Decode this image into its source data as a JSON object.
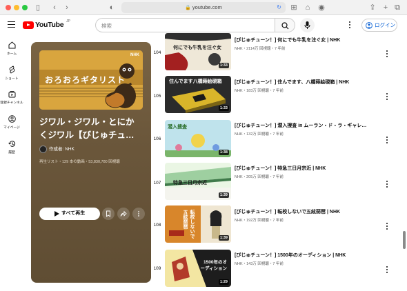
{
  "browser": {
    "url": "youtube.com"
  },
  "header": {
    "logo_text": "YouTube",
    "logo_region": "JP",
    "search_placeholder": "検索",
    "login_label": "ログイン"
  },
  "nav": [
    {
      "label": "ホーム",
      "icon": "home-icon"
    },
    {
      "label": "ショート",
      "icon": "shorts-icon"
    },
    {
      "label": "登録チャンネル",
      "icon": "subscriptions-icon"
    },
    {
      "label": "マイページ",
      "icon": "account-icon"
    },
    {
      "label": "履歴",
      "icon": "history-icon"
    }
  ],
  "playlist": {
    "thumb_text": "おろおろギタリスト",
    "thumb_brand": "NHK",
    "title_line1": "ジワル・ジワル・とにか",
    "title_line2": "くジワル【びじゅチュ…",
    "owner": "作成者: NHK",
    "meta": "再生リスト・129 本の動画・53,830,780 回視聴",
    "play_all_label": "すべて再生"
  },
  "videos": [
    {
      "index": "104",
      "title": "[びじゅチューン！] 何にでも牛乳を注ぐ女 | NHK",
      "meta": "NHK・2114万 回視聴・7 年前",
      "duration": "1:33",
      "thumb_text": "何にでも牛乳を注ぐ女"
    },
    {
      "index": "105",
      "title": "[びじゅチューン！] 住んでます、八橋蒔絵硯箱 | NHK",
      "meta": "NHK・183万 回視聴・7 年前",
      "duration": "1:33",
      "thumb_text": "住んでます八橋蒔絵硯箱"
    },
    {
      "index": "106",
      "title": "[びじゅチューン！] 潜入捜査 in ムーラン・ド・ラ・ギャレ…",
      "meta": "NHK・132万 回視聴・7 年前",
      "duration": "1:38",
      "thumb_text": "潜入捜査"
    },
    {
      "index": "107",
      "title": "[びじゅチューン！] 特急三日月宗近 | NHK",
      "meta": "NHK・205万 回視聴・7 年前",
      "duration": "1:39",
      "thumb_text": "特急三日月宗近"
    },
    {
      "index": "108",
      "title": "[びじゅチューン！] 転校しないで五絃琵琶 | NHK",
      "meta": "NHK・192万 回視聴・7 年前",
      "duration": "1:39",
      "thumb_text": "転校しないで五絃琵琶"
    },
    {
      "index": "109",
      "title": "[びじゅチューン！] 1500年のオーディション | NHK",
      "meta": "NHK・143万 回視聴・7 年前",
      "duration": "1:29",
      "thumb_text": "1500年のオーディション"
    }
  ]
}
